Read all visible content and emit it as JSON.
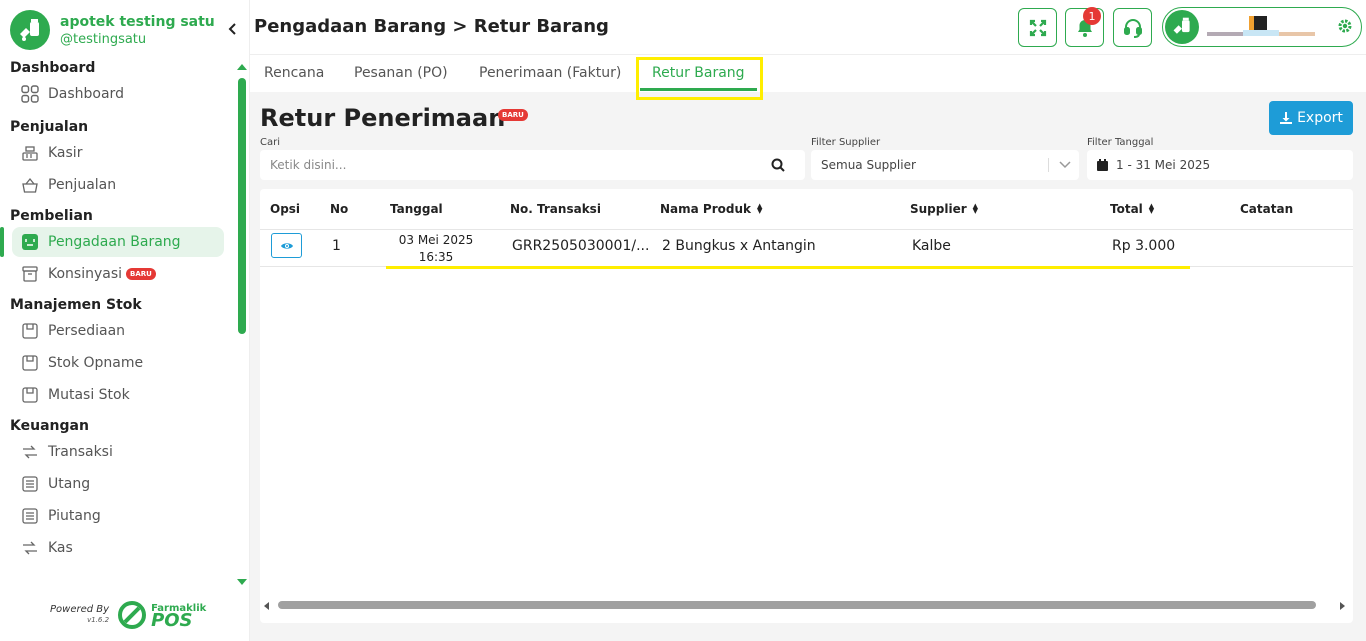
{
  "brand": {
    "name": "apotek testing satu",
    "handle": "@testingsatu"
  },
  "sidebar": {
    "sections": [
      {
        "title": "Dashboard",
        "items": [
          {
            "label": "Dashboard",
            "icon": "grid-icon"
          }
        ]
      },
      {
        "title": "Penjualan",
        "items": [
          {
            "label": "Kasir",
            "icon": "cash-register-icon"
          },
          {
            "label": "Penjualan",
            "icon": "basket-icon"
          }
        ]
      },
      {
        "title": "Pembelian",
        "items": [
          {
            "label": "Pengadaan Barang",
            "icon": "procurement-icon",
            "active": true
          },
          {
            "label": "Konsinyasi",
            "icon": "archive-box-icon",
            "badge": "BARU"
          }
        ]
      },
      {
        "title": "Manajemen Stok",
        "items": [
          {
            "label": "Persediaan",
            "icon": "box-icon"
          },
          {
            "label": "Stok Opname",
            "icon": "box-icon"
          },
          {
            "label": "Mutasi Stok",
            "icon": "box-icon"
          }
        ]
      },
      {
        "title": "Keuangan",
        "items": [
          {
            "label": "Transaksi",
            "icon": "transfer-icon"
          },
          {
            "label": "Utang",
            "icon": "ledger-icon"
          },
          {
            "label": "Piutang",
            "icon": "ledger-icon"
          },
          {
            "label": "Kas",
            "icon": "transfer-icon"
          }
        ]
      }
    ]
  },
  "powered": {
    "label": "Powered By",
    "version": "v1.6.2",
    "logo_name": "Farmaklik",
    "logo_pos": "POS"
  },
  "header": {
    "title": "Pengadaan Barang > Retur Barang",
    "notif_count": "1"
  },
  "tabs": [
    {
      "label": "Rencana"
    },
    {
      "label": "Pesanan (PO)"
    },
    {
      "label": "Penerimaan (Faktur)"
    },
    {
      "label": "Retur Barang",
      "active": true
    }
  ],
  "main": {
    "heading": "Retur Penerimaan",
    "heading_badge": "BARU",
    "export_label": "Export",
    "search": {
      "label": "Cari",
      "placeholder": "Ketik disini..."
    },
    "supplier_filter": {
      "label": "Filter Supplier",
      "value": "Semua Supplier"
    },
    "date_filter": {
      "label": "Filter Tanggal",
      "value": "1 - 31 Mei 2025"
    }
  },
  "table": {
    "columns": [
      "Opsi",
      "No",
      "Tanggal",
      "No. Transaksi",
      "Nama Produk",
      "Supplier",
      "Total",
      "Catatan"
    ],
    "rows": [
      {
        "no": "1",
        "date": "03 Mei 2025",
        "time": "16:35",
        "transaction": "GRR2505030001/...",
        "product": "2 Bungkus x Antangin",
        "supplier": "Kalbe",
        "total": "Rp 3.000",
        "note": ""
      }
    ]
  },
  "colors": {
    "brand_green": "#2eaa4f",
    "export_blue": "#1e9cd7",
    "badge_red": "#e53935",
    "highlight_yellow": "#ffee00"
  }
}
